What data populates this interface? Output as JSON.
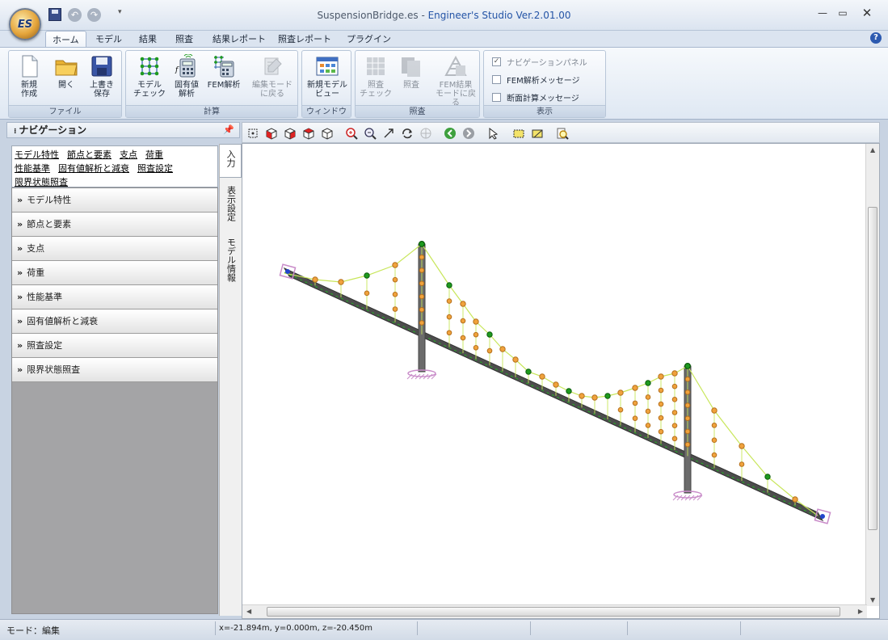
{
  "window": {
    "file_name": "SuspensionBridge.es",
    "separator": " - ",
    "app_name": "Engineer's Studio Ver.2.01.00",
    "orb_label": "ES"
  },
  "tabs": [
    {
      "label": "ホーム",
      "active": true
    },
    {
      "label": "モデル"
    },
    {
      "label": "結果"
    },
    {
      "label": "照査"
    },
    {
      "label": "結果レポート"
    },
    {
      "label": "照査レポート"
    },
    {
      "label": "プラグイン"
    }
  ],
  "ribbon": {
    "file_group": {
      "label": "ファイル",
      "new": "新規\n作成",
      "open": "開く",
      "save": "上書き\n保存"
    },
    "calc_group": {
      "label": "計算",
      "model_check": "モデル\nチェック",
      "eigen": "固有値\n解析",
      "fem": "FEM解析",
      "back_to_edit": "編集モード\nに戻る"
    },
    "window_group": {
      "label": "ウィンドウ",
      "new_view": "新規モデル\nビュー"
    },
    "check_group": {
      "label": "照査",
      "check_check": "照査\nチェック",
      "check": "照査",
      "back_to_fem": "FEM結果\nモードに戻る"
    },
    "display_group": {
      "label": "表示",
      "nav_panel": "ナビゲーションパネル",
      "fem_msg": "FEM解析メッセージ",
      "section_msg": "断面計算メッセージ"
    }
  },
  "navigation": {
    "title": "ナビゲーション",
    "pin": "ꟼ",
    "links": [
      "モデル特性",
      "節点と要素",
      "支点",
      "荷重",
      "性能基準",
      "固有値解析と減衰",
      "照査設定",
      "限界状態照査"
    ],
    "items": [
      "モデル特性",
      "節点と要素",
      "支点",
      "荷重",
      "性能基準",
      "固有値解析と減衰",
      "照査設定",
      "限界状態照査"
    ],
    "side_tabs": [
      "入力",
      "表示設定",
      "モデル情報"
    ]
  },
  "status": {
    "mode": "モード：編集",
    "coords": "x=-21.894m, y=0.000m, z=-20.450m"
  },
  "colors": {
    "deck": "#4d4d4d",
    "tower": "#6b6b6b",
    "cable": "#c8e65a",
    "hanger_node": "#f0a23c",
    "cable_node": "#1e9a1e",
    "support": "#c98cc9"
  }
}
